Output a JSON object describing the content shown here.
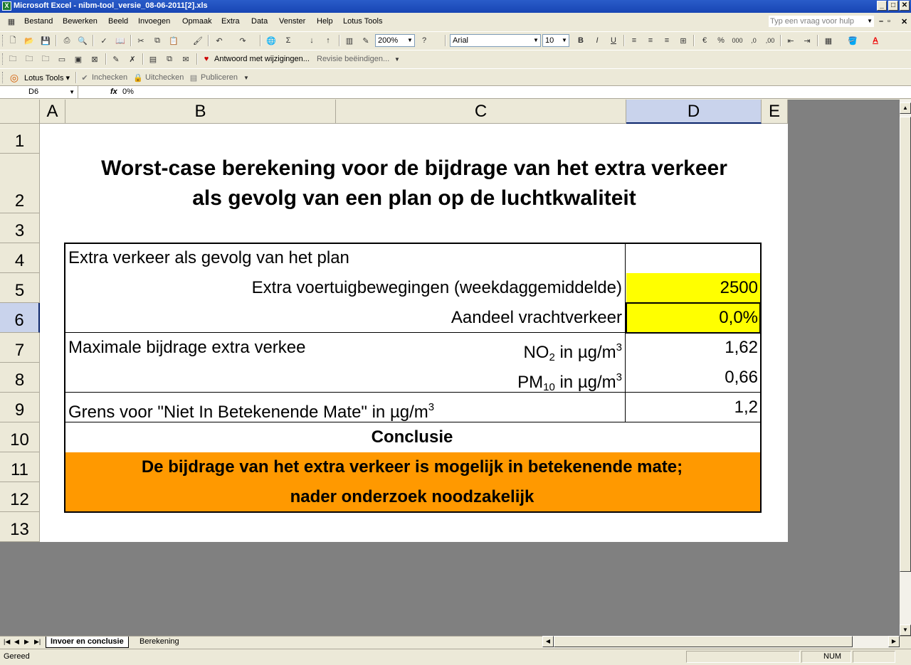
{
  "window": {
    "title": "Microsoft Excel - nibm-tool_versie_08-06-2011[2].xls",
    "min": "_",
    "max": "□",
    "close": "✕"
  },
  "menu": {
    "items": [
      "Bestand",
      "Bewerken",
      "Beeld",
      "Invoegen",
      "Opmaak",
      "Extra",
      "Data",
      "Venster",
      "Help",
      "Lotus Tools"
    ],
    "help_placeholder": "Typ een vraag voor hulp"
  },
  "toolbar1": {
    "zoom": "200%",
    "font": "Arial",
    "size": "10",
    "sigma": "Σ",
    "bold": "B",
    "italic": "I",
    "underline": "U",
    "percent": "%",
    "thousands": "000",
    "incdec": ",0",
    "decdec": ",00",
    "fontcolor": "A"
  },
  "toolbar2": {
    "reply": "Antwoord met wijzigingen...",
    "end_review": "Revisie beëindigen..."
  },
  "toolbar3": {
    "lotus": "Lotus Tools",
    "checkin": "Inchecken",
    "checkout": "Uitchecken",
    "publish": "Publiceren"
  },
  "formula": {
    "namebox": "D6",
    "fx": "fx",
    "value": "0%"
  },
  "columns": [
    "A",
    "B",
    "C",
    "D",
    "E"
  ],
  "rows": [
    "1",
    "2",
    "3",
    "4",
    "5",
    "6",
    "7",
    "8",
    "9",
    "10",
    "11",
    "12",
    "13"
  ],
  "sheet": {
    "title_line1": "Worst-case berekening voor de bijdrage van het extra verkeer",
    "title_line2": "als gevolg van een plan op de luchtkwaliteit",
    "r4_label": "Extra verkeer als gevolg van het plan",
    "r5_label": "Extra voertuigbewegingen (weekdaggemiddelde)",
    "r5_value": "2500",
    "r6_label": "Aandeel vrachtverkeer",
    "r6_value": "0,0%",
    "r7_label": "Maximale bijdrage extra verkee",
    "r7_pollutant": "NO",
    "r7_sub": "2",
    "r7_unit": " in µg/m",
    "r7_sup": "3",
    "r7_value": "1,62",
    "r8_pollutant": "PM",
    "r8_sub": "10",
    "r8_unit": " in µg/m",
    "r8_sup": "3",
    "r8_value": "0,66",
    "r9_label": "Grens voor \"Niet In Betekenende Mate\" in µg/m",
    "r9_sup": "3",
    "r9_value": "1,2",
    "conclusion_header": "Conclusie",
    "conclusion_line1": "De bijdrage van het extra verkeer is mogelijk in betekenende mate;",
    "conclusion_line2": "nader onderzoek noodzakelijk"
  },
  "tabs": {
    "active": "Invoer en conclusie",
    "other": "Berekening"
  },
  "status": {
    "text": "Gereed",
    "num": "NUM"
  },
  "colors": {
    "input_fill": "#ffff00",
    "conclusion_fill": "#ff9900"
  }
}
